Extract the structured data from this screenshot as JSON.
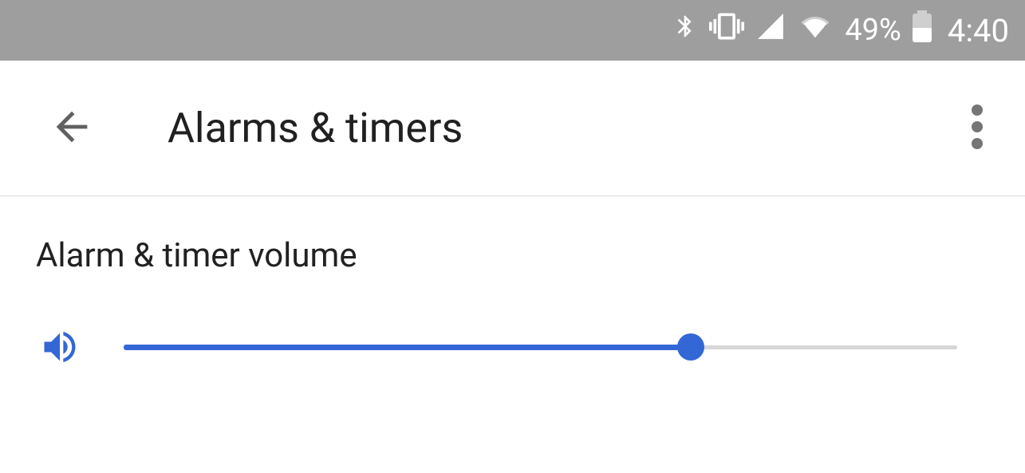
{
  "status_bar": {
    "battery_pct": "49%",
    "time": "4:40"
  },
  "app_bar": {
    "title": "Alarms & timers"
  },
  "content": {
    "section_label": "Alarm & timer volume",
    "slider_value_pct": 68
  },
  "colors": {
    "accent": "#3367d6",
    "status_bg": "#9e9e9e"
  }
}
